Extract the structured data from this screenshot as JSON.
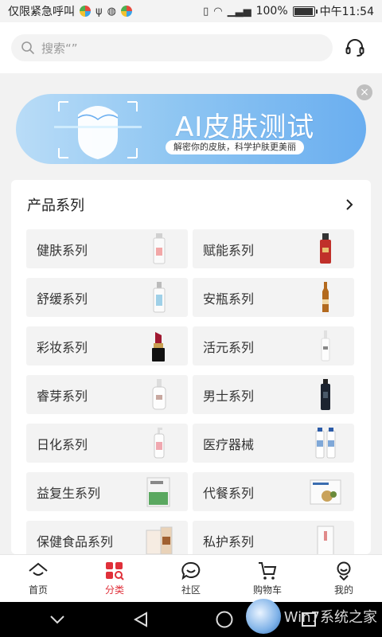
{
  "status": {
    "carrier_text": "仅限紧急呼叫",
    "battery": "100%",
    "battery_level": 1.0,
    "time": "中午11:54"
  },
  "search": {
    "placeholder": "搜索“”"
  },
  "banner": {
    "title": "AI皮肤测试",
    "subtitle": "解密你的皮肤，科学护肤更美丽",
    "close": "×"
  },
  "products": {
    "title": "产品系列",
    "items": [
      {
        "label": "健肤系列",
        "icon": "white-lotion-bottle-icon"
      },
      {
        "label": "赋能系列",
        "icon": "red-serum-bottle-icon"
      },
      {
        "label": "舒缓系列",
        "icon": "white-pump-bottle-icon"
      },
      {
        "label": "安瓶系列",
        "icon": "amber-ampoule-icon"
      },
      {
        "label": "彩妆系列",
        "icon": "lipstick-icon"
      },
      {
        "label": "活元系列",
        "icon": "dropper-bottle-icon"
      },
      {
        "label": "睿芽系列",
        "icon": "white-pump-bottle-icon"
      },
      {
        "label": "男士系列",
        "icon": "black-bottle-icon"
      },
      {
        "label": "日化系列",
        "icon": "pump-bottle-icon"
      },
      {
        "label": "医疗器械",
        "icon": "medical-bottles-icon"
      },
      {
        "label": "益复生系列",
        "icon": "supplement-box-icon"
      },
      {
        "label": "代餐系列",
        "icon": "meal-box-icon"
      },
      {
        "label": "保健食品系列",
        "icon": "health-food-box-icon"
      },
      {
        "label": "私护系列",
        "icon": "care-box-icon"
      }
    ]
  },
  "nav": {
    "items": [
      {
        "label": "首页",
        "icon": "home-icon",
        "active": false
      },
      {
        "label": "分类",
        "icon": "category-icon",
        "active": true
      },
      {
        "label": "社区",
        "icon": "community-icon",
        "active": false
      },
      {
        "label": "购物车",
        "icon": "cart-icon",
        "active": false
      },
      {
        "label": "我的",
        "icon": "profile-icon",
        "active": false
      }
    ]
  },
  "colors": {
    "accent": "#e0303a",
    "banner": "#8fc6f2"
  },
  "watermark": {
    "text": "Win7系统之家"
  }
}
